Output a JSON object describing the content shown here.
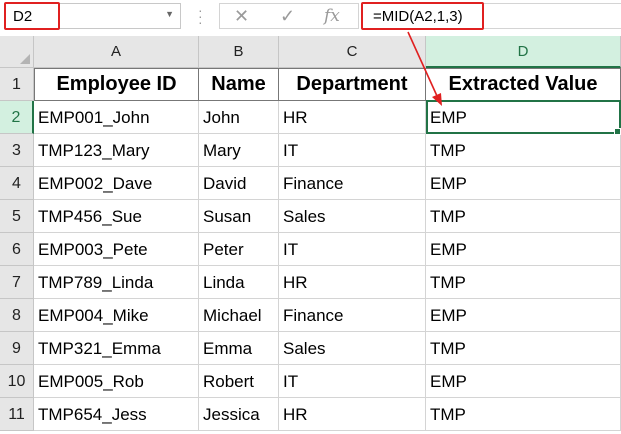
{
  "formula_bar": {
    "name_box": "D2",
    "formula": "=MID(A2,1,3)",
    "icons": {
      "cancel": "close-icon",
      "enter": "check-icon",
      "function": "fx-icon"
    },
    "cancel_glyph": "✕",
    "enter_glyph": "✓",
    "fx_glyph": "fx"
  },
  "sheet": {
    "columns": [
      "A",
      "B",
      "C",
      "D"
    ],
    "headers": [
      "Employee ID",
      "Name",
      "Department",
      "Extracted Value"
    ],
    "rows": [
      {
        "num": "1"
      },
      {
        "num": "2",
        "cells": [
          "EMP001_John",
          "John",
          "HR",
          "EMP"
        ]
      },
      {
        "num": "3",
        "cells": [
          "TMP123_Mary",
          "Mary",
          "IT",
          "TMP"
        ]
      },
      {
        "num": "4",
        "cells": [
          "EMP002_Dave",
          "David",
          "Finance",
          "EMP"
        ]
      },
      {
        "num": "5",
        "cells": [
          "TMP456_Sue",
          "Susan",
          "Sales",
          "TMP"
        ]
      },
      {
        "num": "6",
        "cells": [
          "EMP003_Pete",
          "Peter",
          "IT",
          "EMP"
        ]
      },
      {
        "num": "7",
        "cells": [
          "TMP789_Linda",
          "Linda",
          "HR",
          "TMP"
        ]
      },
      {
        "num": "8",
        "cells": [
          "EMP004_Mike",
          "Michael",
          "Finance",
          "EMP"
        ]
      },
      {
        "num": "9",
        "cells": [
          "TMP321_Emma",
          "Emma",
          "Sales",
          "TMP"
        ]
      },
      {
        "num": "10",
        "cells": [
          "EMP005_Rob",
          "Robert",
          "IT",
          "EMP"
        ]
      },
      {
        "num": "11",
        "cells": [
          "TMP654_Jess",
          "Jessica",
          "HR",
          "TMP"
        ]
      }
    ],
    "active_cell": "D2"
  },
  "colors": {
    "highlight": "#e02020",
    "selection": "#217346",
    "header_bg": "#e6e6e6"
  }
}
